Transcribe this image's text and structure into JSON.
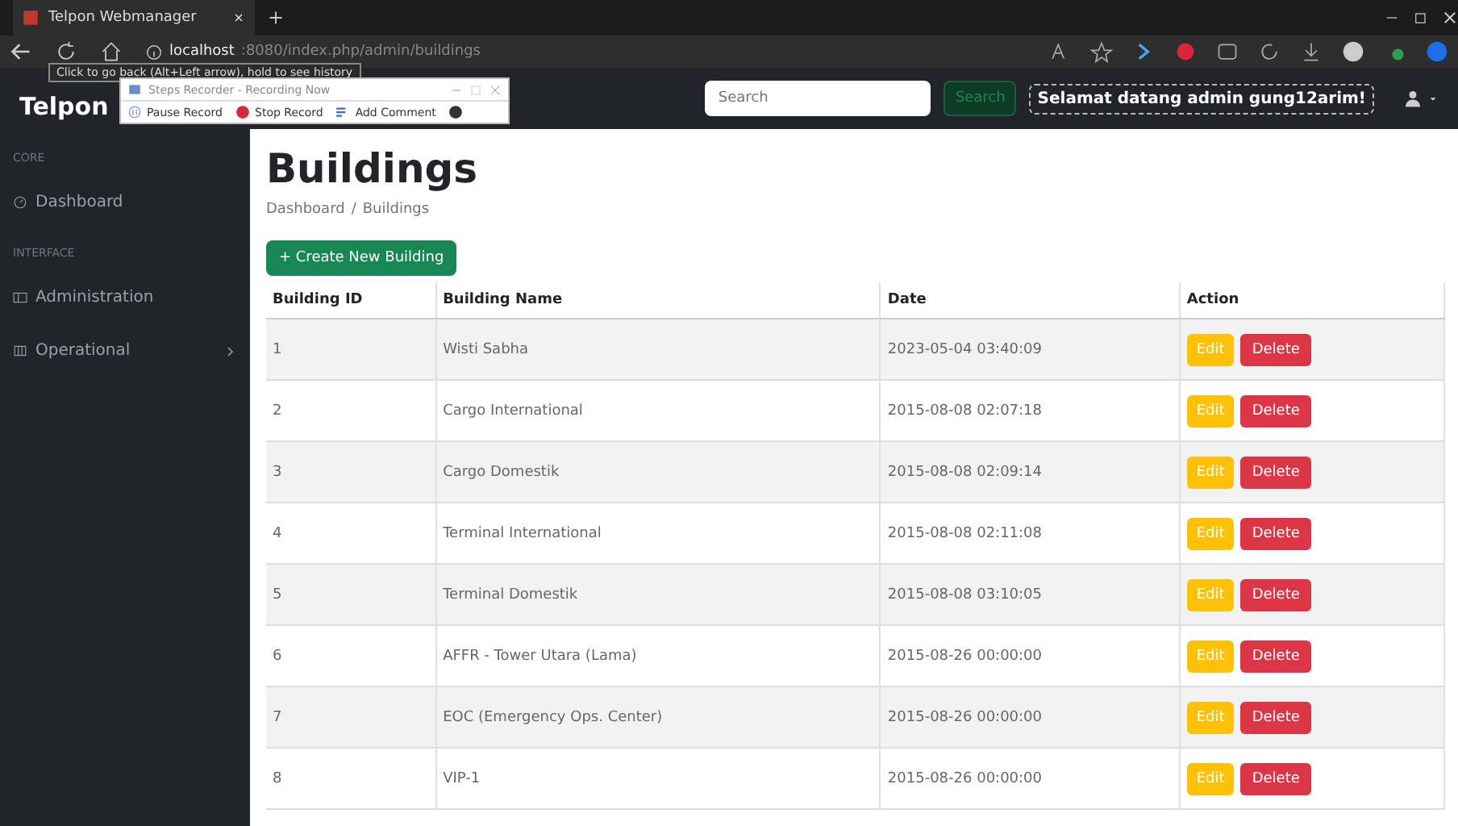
{
  "browser": {
    "tab_title": "Telpon Webmanager",
    "address_host": "localhost",
    "address_path": ":8080/index.php/admin/buildings",
    "tooltip": "Click to go back (Alt+Left arrow), hold to see history"
  },
  "recorder": {
    "title": "Steps Recorder - Recording Now",
    "buttons": [
      "Pause Record",
      "Stop Record",
      "Add Comment"
    ]
  },
  "navbar": {
    "brand": "Telpon",
    "search": {
      "placeholder": "Search"
    },
    "search_button": "Search",
    "welcome": "Selamat datang admin gung12arim!"
  },
  "sidebar": {
    "sections": [
      {
        "heading": "CORE",
        "items": [
          {
            "label": "Dashboard",
            "collapsible": false
          }
        ]
      },
      {
        "heading": "INTERFACE",
        "items": [
          {
            "label": "Administration",
            "collapsible": false
          },
          {
            "label": "Operational",
            "collapsible": true
          }
        ]
      }
    ]
  },
  "page": {
    "title": "Buildings",
    "breadcrumb": [
      "Dashboard",
      "Buildings"
    ],
    "breadcrumb_separator": "/",
    "create_button": "+ Create New Building"
  },
  "table": {
    "columns": [
      "Building ID",
      "Building Name",
      "Date",
      "Action"
    ],
    "rows": [
      {
        "id": "1",
        "name": "Wisti Sabha",
        "date": "2023-05-04 03:40:09",
        "actions": [
          "Edit",
          "Delete"
        ]
      },
      {
        "id": "2",
        "name": "Cargo International",
        "date": "2015-08-08 02:07:18",
        "actions": [
          "Edit",
          "Delete"
        ]
      },
      {
        "id": "3",
        "name": "Cargo Domestik",
        "date": "2015-08-08 02:09:14",
        "actions": [
          "Edit",
          "Delete"
        ]
      },
      {
        "id": "4",
        "name": "Terminal International",
        "date": "2015-08-08 02:11:08",
        "actions": [
          "Edit",
          "Delete"
        ]
      },
      {
        "id": "5",
        "name": "Terminal Domestik",
        "date": "2015-08-08 03:10:05",
        "actions": [
          "Edit",
          "Delete"
        ]
      },
      {
        "id": "6",
        "name": "AFFR - Tower Utara (Lama)",
        "date": "2015-08-26 00:00:00",
        "actions": [
          "Edit",
          "Delete"
        ]
      },
      {
        "id": "7",
        "name": "EOC (Emergency Ops. Center)",
        "date": "2015-08-26 00:00:00",
        "actions": [
          "Edit",
          "Delete"
        ]
      },
      {
        "id": "8",
        "name": "VIP-1",
        "date": "2015-08-26 00:00:00",
        "actions": [
          "Edit",
          "Delete"
        ]
      }
    ]
  }
}
